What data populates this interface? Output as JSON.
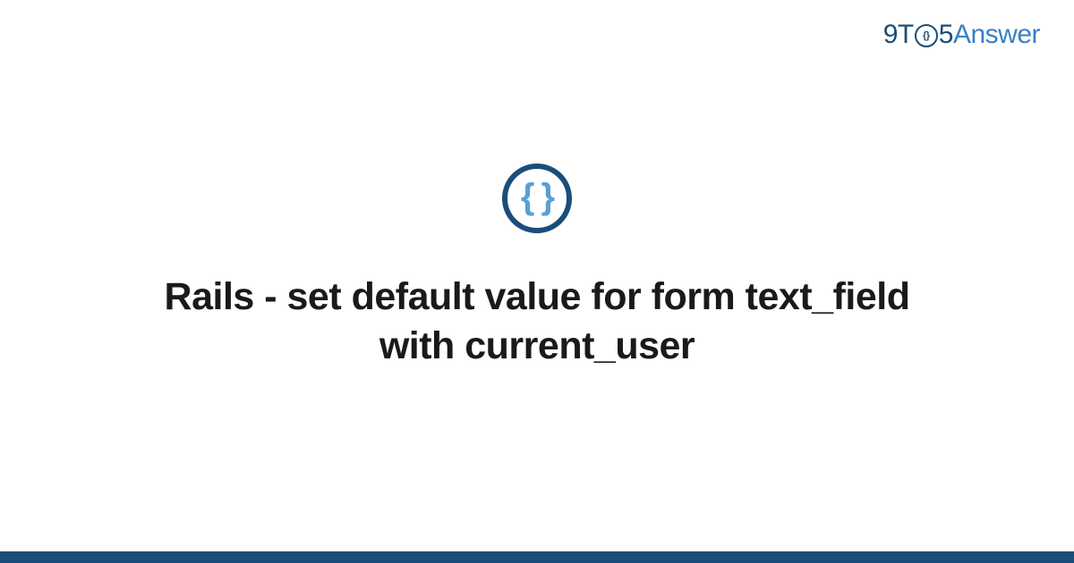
{
  "header": {
    "logo_9t": "9T",
    "logo_clock_inner": "{}",
    "logo_5": "5",
    "logo_answer": "Answer"
  },
  "icon": {
    "braces": "{ }"
  },
  "title": "Rails - set default value for form text_field with current_user",
  "colors": {
    "brand_dark": "#1a4d7a",
    "brand_light": "#3b7fc4",
    "icon_braces": "#5a9fd4"
  }
}
